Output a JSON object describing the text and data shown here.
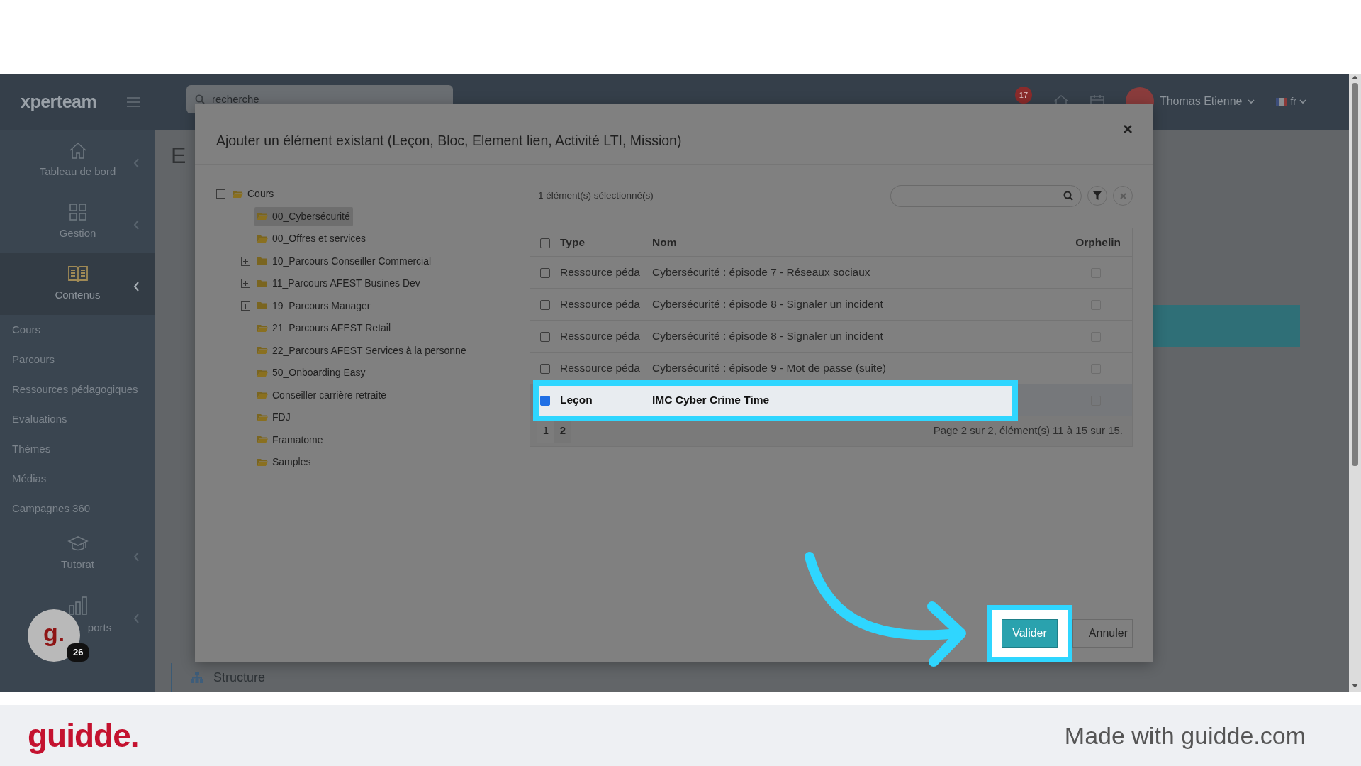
{
  "topbar": {
    "logo": "xperteam",
    "search": {
      "placeholder": "recherche"
    },
    "notifications": "17",
    "user": "Thomas Etienne",
    "language": "fr"
  },
  "sidebar": {
    "items": [
      {
        "kind": "section",
        "label": "Tableau de bord",
        "selected": false,
        "expanded": false
      },
      {
        "kind": "section",
        "label": "Gestion",
        "selected": false,
        "expanded": false
      },
      {
        "kind": "section",
        "label": "Contenus",
        "selected": true,
        "expanded": true
      },
      {
        "kind": "link",
        "label": "Cours",
        "selected": false
      },
      {
        "kind": "link",
        "label": "Parcours",
        "selected": false
      },
      {
        "kind": "link",
        "label": "Ressources pédagogiques",
        "selected": false
      },
      {
        "kind": "link",
        "label": "Evaluations",
        "selected": false
      },
      {
        "kind": "link",
        "label": "Thèmes",
        "selected": false
      },
      {
        "kind": "link",
        "label": "Médias",
        "selected": false
      },
      {
        "kind": "link",
        "label": "Campagnes 360",
        "selected": false
      },
      {
        "kind": "section",
        "label": "Tutorat",
        "selected": false,
        "expanded": false
      },
      {
        "kind": "section",
        "label": "ports",
        "selected": false,
        "expanded": false
      }
    ]
  },
  "page": {
    "heading": "E",
    "structure_label": "Structure"
  },
  "modal": {
    "title": "Ajouter un élément existant (Leçon, Bloc, Element lien, Activité LTI, Mission)",
    "close": "×",
    "tree": [
      {
        "label": "Cours",
        "kind": "branch",
        "expanded": true,
        "selected": false,
        "children": [
          {
            "label": "00_Cybersécurité",
            "kind": "leaf",
            "expanded": false,
            "selected": true
          },
          {
            "label": "00_Offres et services",
            "kind": "leaf",
            "expanded": false,
            "selected": false
          },
          {
            "label": "10_Parcours Conseiller Commercial",
            "kind": "branch",
            "expanded": false,
            "selected": false
          },
          {
            "label": "11_Parcours AFEST Busines Dev",
            "kind": "branch",
            "expanded": false,
            "selected": false
          },
          {
            "label": "19_Parcours Manager",
            "kind": "branch",
            "expanded": false,
            "selected": false
          },
          {
            "label": "21_Parcours AFEST Retail",
            "kind": "leaf",
            "expanded": false,
            "selected": false
          },
          {
            "label": "22_Parcours AFEST Services à la personne",
            "kind": "leaf",
            "expanded": false,
            "selected": false
          },
          {
            "label": "50_Onboarding Easy",
            "kind": "leaf",
            "expanded": false,
            "selected": false
          },
          {
            "label": "Conseiller carrière retraite",
            "kind": "leaf",
            "expanded": false,
            "selected": false
          },
          {
            "label": "FDJ",
            "kind": "leaf",
            "expanded": false,
            "selected": false
          },
          {
            "label": "Framatome",
            "kind": "leaf",
            "expanded": false,
            "selected": false
          },
          {
            "label": "Samples",
            "kind": "leaf",
            "expanded": false,
            "selected": false
          }
        ]
      }
    ],
    "selection_count": "1 élément(s) sélectionné(s)",
    "table": {
      "columns": [
        "Type",
        "Nom",
        "Orphelin"
      ],
      "all_checked": false,
      "rows": [
        {
          "checked": false,
          "selected": false,
          "annotated": false,
          "type": "Ressource péda",
          "name": "Cybersécurité : épisode 7 - Réseaux sociaux",
          "orphan": false
        },
        {
          "checked": false,
          "selected": false,
          "annotated": false,
          "type": "Ressource péda",
          "name": "Cybersécurité : épisode 8 - Signaler un incident",
          "orphan": false
        },
        {
          "checked": false,
          "selected": false,
          "annotated": false,
          "type": "Ressource péda",
          "name": "Cybersécurité : épisode 8 - Signaler un incident",
          "orphan": false
        },
        {
          "checked": false,
          "selected": false,
          "annotated": false,
          "type": "Ressource péda",
          "name": "Cybersécurité : épisode 9 - Mot de passe (suite)",
          "orphan": false
        },
        {
          "checked": true,
          "selected": true,
          "annotated": true,
          "type": "Leçon",
          "name": "IMC Cyber Crime Time",
          "orphan": false
        }
      ]
    },
    "pages": [
      {
        "label": "1",
        "selected": false
      },
      {
        "label": "2",
        "selected": true
      }
    ],
    "page_summary": "Page 2 sur 2, élément(s) 11 à 15 sur 15.",
    "buttons": [
      {
        "label": "Valider",
        "kind": "primary",
        "annotated": true
      },
      {
        "label": "Annuler",
        "kind": "secondary",
        "annotated": false
      }
    ]
  },
  "guidde": {
    "bubble": "g.",
    "count": "26",
    "logo": "guidde.",
    "credit": "Made with guidde.com"
  }
}
